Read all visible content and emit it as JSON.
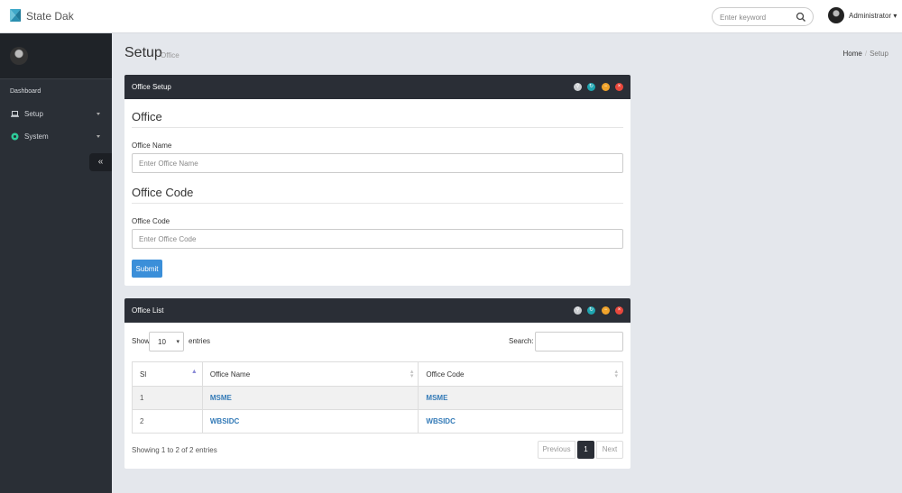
{
  "app": {
    "name": "State Dak",
    "search_placeholder": "Enter keyword",
    "user": "Administrator"
  },
  "sidebar": {
    "section_label": "Dashboard",
    "items": [
      {
        "label": "Setup",
        "icon": "laptop-icon"
      },
      {
        "label": "System",
        "icon": "gear-icon"
      }
    ],
    "collapse_glyph": "«"
  },
  "page": {
    "title": "Setup",
    "subtitle": "Office",
    "breadcrumb": [
      "Home",
      "Setup"
    ]
  },
  "setup_panel": {
    "title": "Office Setup",
    "section1_title": "Office",
    "office_name_label": "Office Name",
    "office_name_placeholder": "Enter Office Name",
    "section2_title": "Office Code",
    "office_code_label": "Office Code",
    "office_code_placeholder": "Enter Office Code",
    "submit_label": "Submit"
  },
  "list_panel": {
    "title": "Office List",
    "show_label": "Show",
    "page_length": "10",
    "entries_label": "entries",
    "search_label": "Search:",
    "columns": [
      "Sl",
      "Office Name",
      "Office Code"
    ],
    "rows": [
      {
        "sl": "1",
        "name": "MSME",
        "code": "MSME"
      },
      {
        "sl": "2",
        "name": "WBSIDC",
        "code": "WBSIDC"
      }
    ],
    "info": "Showing 1 to 2 of 2 entries",
    "pagination": {
      "prev": "Previous",
      "current": "1",
      "next": "Next"
    }
  },
  "colors": {
    "header_dark": "#2a2e36",
    "sidebar": "#2a2f36",
    "primary": "#3b8fd9",
    "link": "#337ab7",
    "btn_grey": "#c9ccd0",
    "btn_teal": "#1fa5b0",
    "btn_orange": "#f0a32b",
    "btn_red": "#e9483c"
  }
}
